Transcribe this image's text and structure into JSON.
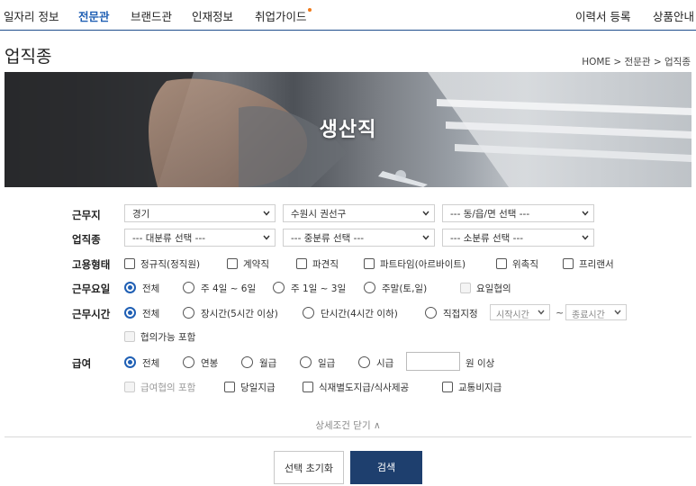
{
  "nav": {
    "items": [
      "일자리 정보",
      "전문관",
      "브랜드관",
      "인재정보",
      "취업가이드"
    ],
    "active_index": 1,
    "right_items": [
      "이력서 등록",
      "상품안내"
    ],
    "accent_color": "#1f5fb4",
    "new_dot_color": "#f07a1a"
  },
  "page": {
    "title": "업직종",
    "breadcrumb": "HOME > 전문관 > 업직종"
  },
  "banner": {
    "title": "생산직"
  },
  "form": {
    "location": {
      "label": "근무지",
      "selects": [
        "경기",
        "수원시 권선구",
        "--- 동/읍/면 선택 ---"
      ]
    },
    "job_type": {
      "label": "업직종",
      "selects": [
        "--- 대분류 선택 ---",
        "--- 중분류 선택 ---",
        "--- 소분류 선택 ---"
      ]
    },
    "employment": {
      "label": "고용형태",
      "options": [
        "정규직(정직원)",
        "계약직",
        "파견직",
        "파트타임(아르바이트)",
        "위촉직",
        "프리랜서"
      ]
    },
    "work_days": {
      "label": "근무요일",
      "options": [
        "전체",
        "주 4일 ~ 6일",
        "주 1일 ~ 3일",
        "주말(토,일)"
      ],
      "selected": "전체",
      "checkbox": "요일협의"
    },
    "work_hours": {
      "label": "근무시간",
      "options": [
        "전체",
        "장시간(5시간 이상)",
        "단시간(4시간 이하)",
        "직접지정"
      ],
      "selected": "전체",
      "start_select": "시작시간",
      "end_select": "종료시간",
      "tilde": "~",
      "checkbox": "협의가능 포함"
    },
    "salary": {
      "label": "급여",
      "options": [
        "전체",
        "연봉",
        "월급",
        "일급",
        "시급"
      ],
      "selected": "전체",
      "input_value": "",
      "unit": "원 이상",
      "checkboxes": [
        "급여협의 포함",
        "당일지급",
        "식재별도지급/식사제공",
        "교통비지급"
      ]
    }
  },
  "toggle_detail": "상세조건 닫기 ∧",
  "buttons": {
    "reset": "선택 초기화",
    "search": "검색"
  }
}
